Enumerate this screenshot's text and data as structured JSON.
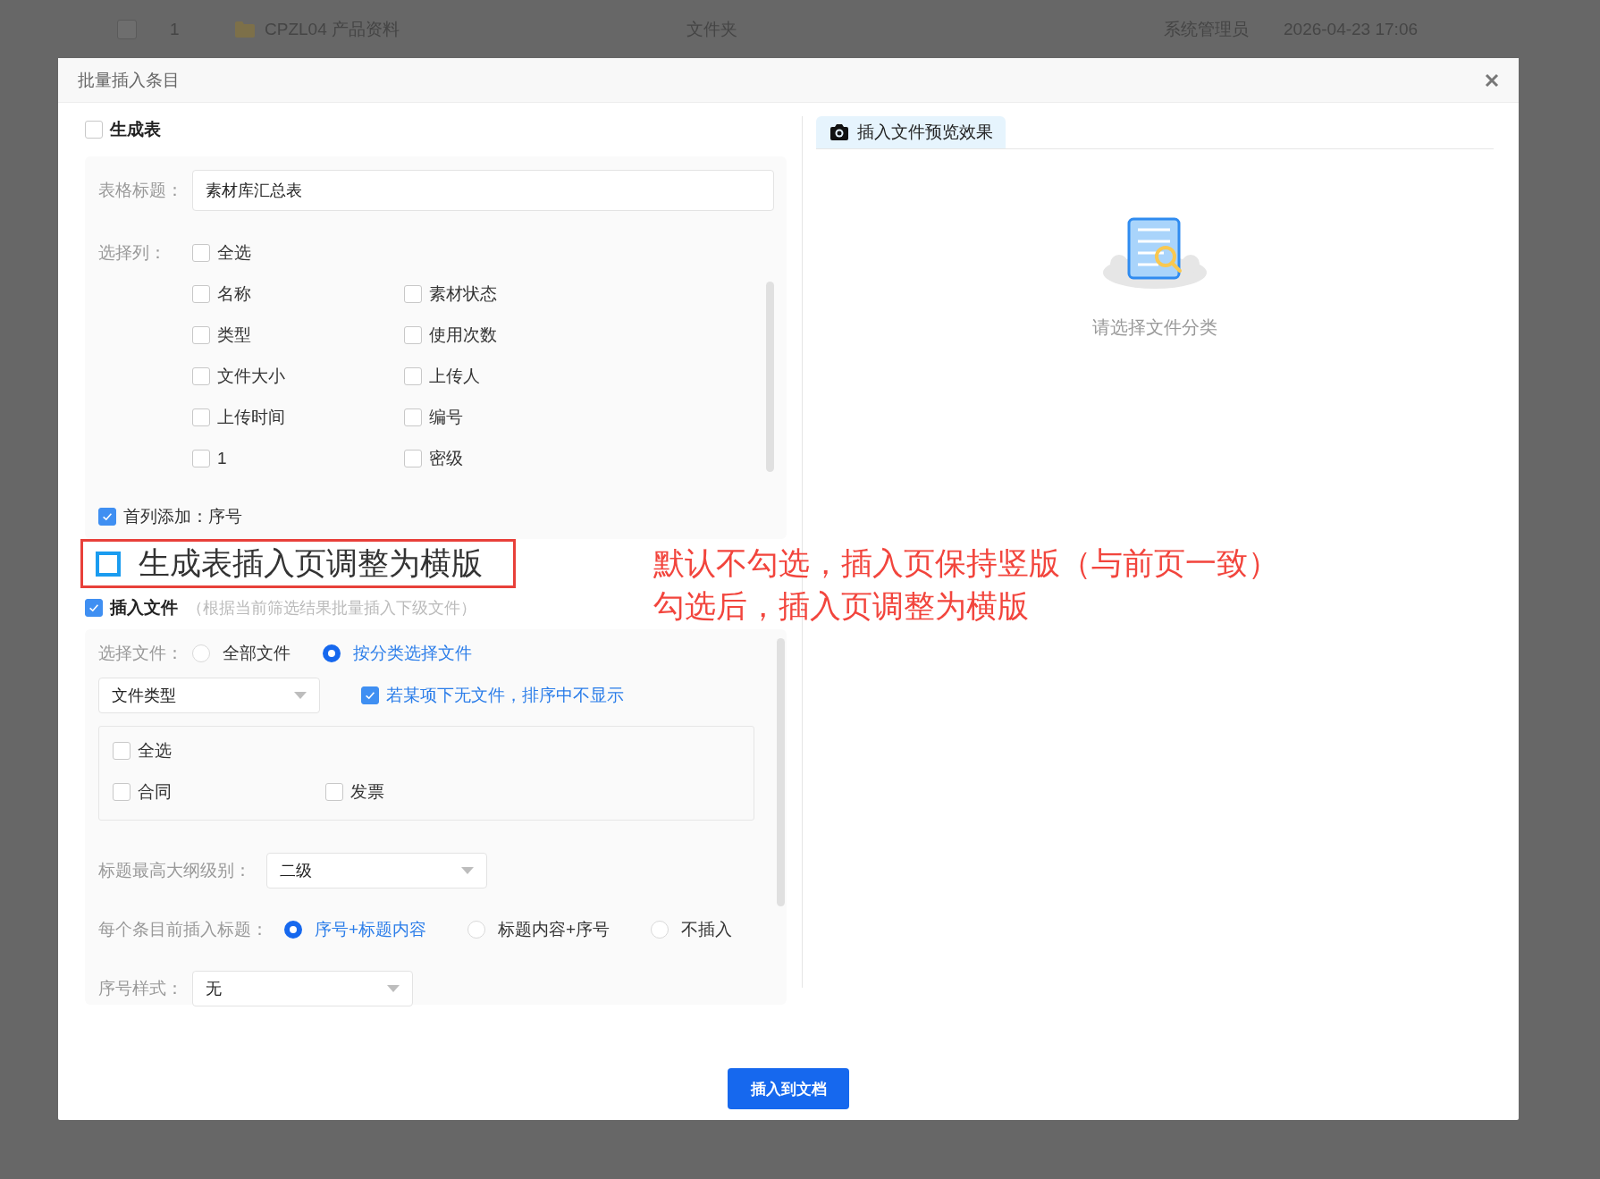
{
  "background_row": {
    "checked": false,
    "index": "1",
    "name": "CPZL04 产品资料",
    "type": "文件夹",
    "owner": "系统管理员",
    "time": "2026-04-23 17:06"
  },
  "dialog": {
    "title": "批量插入条目"
  },
  "generate_table": {
    "label": "生成表",
    "checked": false
  },
  "table_title": {
    "label": "表格标题：",
    "value": "素材库汇总表"
  },
  "columns": {
    "label": "选择列：",
    "select_all": {
      "label": "全选",
      "checked": false
    },
    "items": [
      {
        "label": "名称",
        "checked": false
      },
      {
        "label": "素材状态",
        "checked": false
      },
      {
        "label": "类型",
        "checked": false
      },
      {
        "label": "使用次数",
        "checked": false
      },
      {
        "label": "文件大小",
        "checked": false
      },
      {
        "label": "上传人",
        "checked": false
      },
      {
        "label": "上传时间",
        "checked": false
      },
      {
        "label": "编号",
        "checked": false
      },
      {
        "label": "1",
        "checked": false
      },
      {
        "label": "密级",
        "checked": false
      }
    ]
  },
  "first_column": {
    "label": "首列添加：序号",
    "checked": true
  },
  "callout": {
    "label": "生成表插入页调整为横版",
    "checked": false
  },
  "insert_files": {
    "label": "插入文件",
    "hint": "（根据当前筛选结果批量插入下级文件）",
    "checked": true
  },
  "file_mode": {
    "label": "选择文件：",
    "options": [
      {
        "label": "全部文件",
        "selected": false
      },
      {
        "label": "按分类选择文件",
        "selected": true
      }
    ]
  },
  "category_select": {
    "value": "文件类型"
  },
  "hide_empty": {
    "label": "若某项下无文件，排序中不显示",
    "checked": true
  },
  "categories": {
    "select_all": {
      "label": "全选",
      "checked": false
    },
    "items": [
      {
        "label": "合同",
        "checked": false
      },
      {
        "label": "发票",
        "checked": false
      }
    ]
  },
  "outline_level": {
    "label": "标题最高大纲级别：",
    "value": "二级"
  },
  "heading_insert": {
    "label": "每个条目前插入标题：",
    "options": [
      {
        "label": "序号+标题内容",
        "selected": true
      },
      {
        "label": "标题内容+序号",
        "selected": false
      },
      {
        "label": "不插入",
        "selected": false
      }
    ]
  },
  "number_style": {
    "label": "序号样式：",
    "value": "无"
  },
  "preview": {
    "tab": "插入文件预览效果",
    "empty_text": "请选择文件分类"
  },
  "annotation": {
    "lines": [
      "默认不勾选，插入页保持竖版（与前页一致）",
      "勾选后，插入页调整为横版"
    ]
  },
  "submit_button": "插入到文档"
}
